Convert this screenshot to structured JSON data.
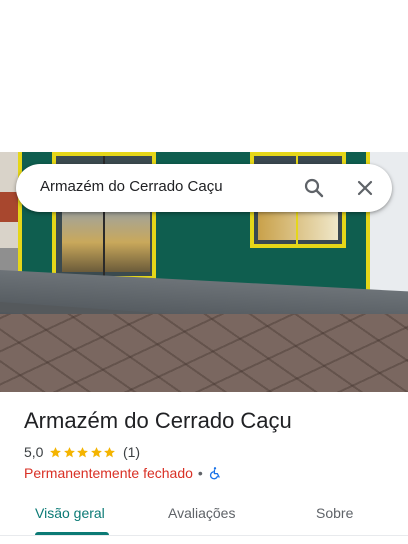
{
  "search": {
    "query": "Armazém do Cerrado Caçu"
  },
  "place": {
    "title": "Armazém do Cerrado Caçu",
    "rating": "5,0",
    "stars": 5,
    "review_count": "(1)",
    "status": "Permanentemente fechado",
    "separator": "•",
    "accessibility_icon": "wheelchair-icon"
  },
  "tabs": [
    {
      "label": "Visão geral",
      "active": true
    },
    {
      "label": "Avaliações",
      "active": false
    },
    {
      "label": "Sobre",
      "active": false
    }
  ],
  "colors": {
    "accent": "#0b7a75",
    "status_closed": "#d93025",
    "star": "#f4b400"
  }
}
